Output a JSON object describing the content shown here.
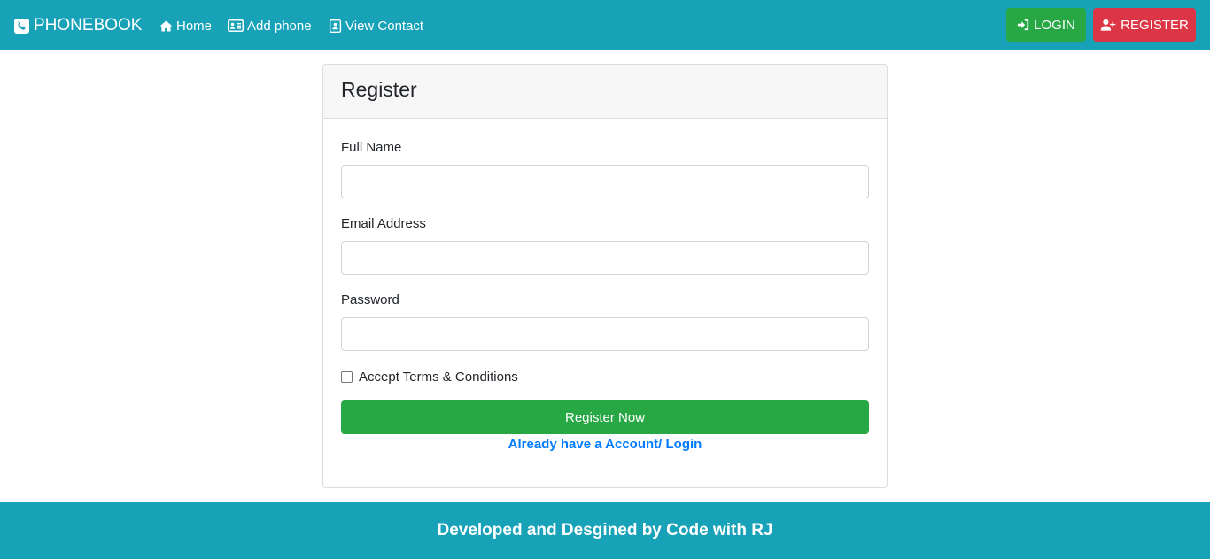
{
  "navbar": {
    "brand": "PHONEBOOK",
    "brand_icon": "phone-square-icon",
    "links": [
      {
        "label": "Home",
        "icon": "home-icon"
      },
      {
        "label": "Add phone",
        "icon": "address-card-icon"
      },
      {
        "label": "View Contact",
        "icon": "contact-book-icon"
      }
    ],
    "login_label": "LOGIN",
    "register_label": "REGISTER"
  },
  "form": {
    "title": "Register",
    "fields": [
      {
        "label": "Full Name",
        "value": ""
      },
      {
        "label": "Email Address",
        "value": ""
      },
      {
        "label": "Password",
        "value": ""
      }
    ],
    "terms_label": "Accept Terms & Conditions",
    "terms_checked": false,
    "submit_label": "Register Now",
    "login_link": "Already have a Account/ Login"
  },
  "footer": {
    "text": "Developed and Desgined by Code with RJ"
  },
  "colors": {
    "navbar": "#17a2b8",
    "success": "#28a745",
    "danger": "#dc3545",
    "link": "#007bff"
  }
}
